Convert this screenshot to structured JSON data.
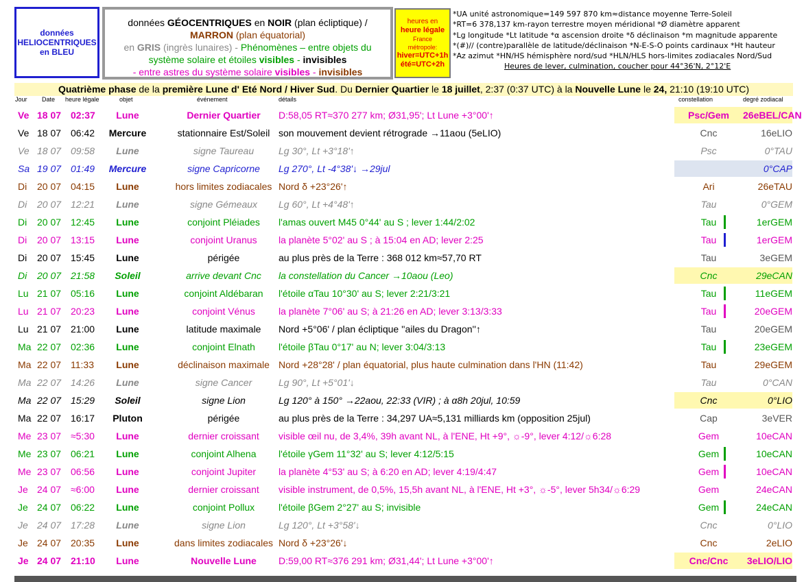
{
  "header": {
    "helio": "données HELIOCENTRIQUES en BLEU",
    "geo_l1_a": "données ",
    "geo_l1_b": "GÉOCENTRIQUES",
    "geo_l1_c": " en ",
    "geo_l1_d": "NOIR",
    "geo_l1_e": " (plan écliptique)  /",
    "geo_l2_a": "MARRON",
    "geo_l2_b": " (plan équatorial)",
    "geo_l3_a": "en ",
    "geo_l3_b": "GRIS",
    "geo_l3_c": " (ingrès lunaires)  -  ",
    "geo_l3_d": "Phénomènes",
    "geo_l3_e": " – entre objets du",
    "geo_l4_a": "système solaire et étoiles ",
    "geo_l4_b": "visibles",
    "geo_l4_c": " - ",
    "geo_l4_d": "invisibles",
    "geo_l5_a": "- entre astres du système solaire ",
    "geo_l5_b": "visibles",
    "geo_l5_c": " - ",
    "geo_l5_d": "invisibles",
    "heures_1": "heures en",
    "heures_2": "heure légale",
    "heures_3": "France",
    "heures_4": "métropole:",
    "heures_5": "hiver=UTC+1h",
    "heures_6": "été=UTC+2h",
    "notes": [
      "*UA unité astronomique=149 597 870 km≈distance moyenne Terre-Soleil",
      "*RT=6 378,137 km-rayon terrestre moyen méridional   *Ø diamètre apparent",
      "*Lg longitude *Lt latitude   *α ascension droite *δ déclinaison   *m magnitude apparente",
      "*(#)// (contre)parallèle de latitude/déclinaison   *N-E-S-O points cardinaux  *Ht hauteur",
      "*Az azimut   *HN/HS hémisphère nord/sud  *HLN/HLS hors-limites zodiacales Nord/Sud"
    ],
    "notes_last": "Heures de lever, culmination, coucher pour 44°36'N, 2°12'E"
  },
  "phase": {
    "p1": "Quatrième phase",
    "p2": " de la ",
    "p3": "première Lune d' Eté Nord / Hiver Sud",
    "p4": ". Du ",
    "p5": "Dernier Quartier",
    "p6": " le ",
    "p7": "18 juillet",
    "p8": ", 2:37 (0:37 UTC) à la ",
    "p9": "Nouvelle Lune",
    "p10": " le ",
    "p11": "24,",
    "p12": " 21:10 (19:10 UTC)"
  },
  "columns": {
    "jour": "Jour",
    "date": "Date",
    "heure": "heure légale",
    "objet": "objet",
    "evenement": "événement",
    "details": "détails",
    "constellation": "constellation",
    "degre": "degré zodiacal"
  },
  "rows": [
    {
      "day": "Ve",
      "date": "18 07",
      "time": "02:37",
      "obj": "Lune",
      "evt": "Dernier Quartier",
      "det": "D:58,05 RT≈370 277 km; Ø31,95'; Lt Lune +3°00'↑",
      "con": "Psc/Gem",
      "deg": "26eBEL/CAN"
    },
    {
      "day": "Ve",
      "date": "18 07",
      "time": "06:42",
      "obj": "Mercure",
      "evt": "stationnaire Est/Soleil",
      "det": "son mouvement devient rétrograde →11aou (5eLIO)",
      "con": "Cnc",
      "deg": "16eLIO"
    },
    {
      "day": "Ve",
      "date": "18 07",
      "time": "09:58",
      "obj": "Lune",
      "evt": "signe Taureau",
      "det": "Lg 30°, Lt +3°18'↑",
      "con": "Psc",
      "deg": "0°TAU"
    },
    {
      "day": "Sa",
      "date": "19 07",
      "time": "01:49",
      "obj": "Mercure",
      "evt": "signe Capricorne",
      "det": "Lg 270°, Lt -4°38'↓ →29jul",
      "con": "",
      "deg": "0°CAP"
    },
    {
      "day": "Di",
      "date": "20 07",
      "time": "04:15",
      "obj": "Lune",
      "evt": "hors limites zodiacales",
      "det": "Nord δ +23°26'↑",
      "con": "Ari",
      "deg": "26eTAU"
    },
    {
      "day": "Di",
      "date": "20 07",
      "time": "12:21",
      "obj": "Lune",
      "evt": "signe Gémeaux",
      "det": "Lg 60°, Lt +4°48'↑",
      "con": "Tau",
      "deg": "0°GEM"
    },
    {
      "day": "Di",
      "date": "20 07",
      "time": "12:45",
      "obj": "Lune",
      "evt": "conjoint Pléiades",
      "det": "l'amas ouvert M45 0°44' au S ; lever 1:44/2:02",
      "con": "Tau",
      "deg": "1erGEM"
    },
    {
      "day": "Di",
      "date": "20 07",
      "time": "13:15",
      "obj": "Lune",
      "evt": "conjoint Uranus",
      "det": "la planète 5°02' au S ; à 15:04 en AD; lever 2:25",
      "con": "Tau",
      "deg": "1erGEM"
    },
    {
      "day": "Di",
      "date": "20 07",
      "time": "15:45",
      "obj": "Lune",
      "evt": "périgée",
      "det": "au plus près de la Terre : 368 012 km≈57,70 RT",
      "con": "Tau",
      "deg": "3eGEM"
    },
    {
      "day": "Di",
      "date": "20 07",
      "time": "21:58",
      "obj": "Soleil",
      "evt": "arrive devant Cnc",
      "det": "la constellation du Cancer →10aou (Leo)",
      "con": "Cnc",
      "deg": "29eCAN"
    },
    {
      "day": "Lu",
      "date": "21 07",
      "time": "05:16",
      "obj": "Lune",
      "evt": "conjoint Aldébaran",
      "det": "l'étoile αTau 10°30' au S; lever 2:21/3:21",
      "con": "Tau",
      "deg": "11eGEM"
    },
    {
      "day": "Lu",
      "date": "21 07",
      "time": "20:23",
      "obj": "Lune",
      "evt": "conjoint Vénus",
      "det": "la planète 7°06' au S; à 21:26 en AD; lever 3:13/3:33",
      "con": "Tau",
      "deg": "20eGEM"
    },
    {
      "day": "Lu",
      "date": "21 07",
      "time": "21:00",
      "obj": "Lune",
      "evt": "latitude maximale",
      "det": "Nord +5°06' / plan écliptique ''ailes du Dragon''↑",
      "con": "Tau",
      "deg": "20eGEM"
    },
    {
      "day": "Ma",
      "date": "22 07",
      "time": "02:36",
      "obj": "Lune",
      "evt": "conjoint Elnath",
      "det": "l'étoile βTau 0°17' au N; lever 3:04/3:13",
      "con": "Tau",
      "deg": "23eGEM"
    },
    {
      "day": "Ma",
      "date": "22 07",
      "time": "11:33",
      "obj": "Lune",
      "evt": "déclinaison maximale",
      "det": "Nord +28°28' / plan équatorial, plus haute culmination dans l'HN (11:42)",
      "con": "Tau",
      "deg": "29eGEM"
    },
    {
      "day": "Ma",
      "date": "22 07",
      "time": "14:26",
      "obj": "Lune",
      "evt": "signe Cancer",
      "det": "Lg 90°, Lt +5°01'↓",
      "con": "Tau",
      "deg": "0°CAN"
    },
    {
      "day": "Ma",
      "date": "22 07",
      "time": "15:29",
      "obj": "Soleil",
      "evt": "signe Lion",
      "det": "Lg 120° à 150° →22aou, 22:33 (VIR) ; à α8h 20jul, 10:59",
      "con": "Cnc",
      "deg": "0°LIO"
    },
    {
      "day": "Ma",
      "date": "22 07",
      "time": "16:17",
      "obj": "Pluton",
      "evt": "périgée",
      "det": "au plus près de la Terre : 34,297 UA≈5,131 milliards km (opposition 25jul)",
      "con": "Cap",
      "deg": "3eVER"
    },
    {
      "day": "Me",
      "date": "23 07",
      "time": "≈5:30",
      "obj": "Lune",
      "evt": "dernier croissant",
      "det": "visible œil nu, de 3,4%, 39h avant NL, à l'ENE, Ht +9°, ☼-9°, lever 4:12/☼6:28",
      "con": "Gem",
      "deg": "10eCAN"
    },
    {
      "day": "Me",
      "date": "23 07",
      "time": "06:21",
      "obj": "Lune",
      "evt": "conjoint Alhena",
      "det": "l'étoile γGem 11°32' au S; lever 4:12/5:15",
      "con": "Gem",
      "deg": "10eCAN"
    },
    {
      "day": "Me",
      "date": "23 07",
      "time": "06:56",
      "obj": "Lune",
      "evt": "conjoint Jupiter",
      "det": "la planète 4°53' au S; à 6:20 en AD; lever 4:19/4:47",
      "con": "Gem",
      "deg": "10eCAN"
    },
    {
      "day": "Je",
      "date": "24 07",
      "time": "≈6:00",
      "obj": "Lune",
      "evt": "dernier croissant",
      "det": "visible instrument, de 0,5%, 15,5h avant NL, à l'ENE, Ht +3°, ☼-5°, lever 5h34/☼6:29",
      "con": "Gem",
      "deg": "24eCAN"
    },
    {
      "day": "Je",
      "date": "24 07",
      "time": "06:22",
      "obj": "Lune",
      "evt": "conjoint Pollux",
      "det": "l'étoile βGem 2°27' au S; invisible",
      "con": "Gem",
      "deg": "24eCAN"
    },
    {
      "day": "Je",
      "date": "24 07",
      "time": "17:28",
      "obj": "Lune",
      "evt": "signe Lion",
      "det": "Lg 120°, Lt +3°58'↓",
      "con": "Cnc",
      "deg": "0°LIO"
    },
    {
      "day": "Je",
      "date": "24 07",
      "time": "20:35",
      "obj": "Lune",
      "evt": "dans limites zodiacales",
      "det": "Nord δ +23°26'↓",
      "con": "Cnc",
      "deg": "2eLIO"
    },
    {
      "day": "Je",
      "date": "24 07",
      "time": "21:10",
      "obj": "Lune",
      "evt": "Nouvelle Lune",
      "det": "D:59,00 RT≈376 291 km; Ø31,44'; Lt Lune +3°00'↑",
      "con": "Cnc/Cnc",
      "deg": "3eLIO/LIO"
    }
  ],
  "colors": {
    "blue": "#1f1fd0",
    "maroon": "#8a3a00",
    "gray": "#888888",
    "green": "#00a000",
    "magenta": "#e000c0",
    "highlight": "#fff8b0"
  }
}
